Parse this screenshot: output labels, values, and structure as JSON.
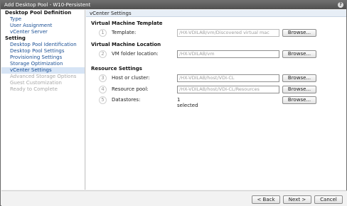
{
  "window": {
    "title": "Add Desktop Pool - W10-Persistent",
    "help_glyph": "?"
  },
  "sidebar": {
    "groups": [
      {
        "heading": "Desktop Pool Definition",
        "items": [
          {
            "label": "Type",
            "state": "normal"
          },
          {
            "label": "User Assignment",
            "state": "normal"
          },
          {
            "label": "vCenter Server",
            "state": "normal"
          }
        ]
      },
      {
        "heading": "Setting",
        "items": [
          {
            "label": "Desktop Pool Identification",
            "state": "normal"
          },
          {
            "label": "Desktop Pool Settings",
            "state": "normal"
          },
          {
            "label": "Provisioning Settings",
            "state": "normal"
          },
          {
            "label": "Storage Optimization",
            "state": "normal"
          },
          {
            "label": "vCenter Settings",
            "state": "selected"
          },
          {
            "label": "Advanced Storage Options",
            "state": "disabled"
          },
          {
            "label": "Guest Customization",
            "state": "disabled"
          },
          {
            "label": "Ready to Complete",
            "state": "disabled"
          }
        ]
      }
    ]
  },
  "content": {
    "header": "vCenter Settings",
    "sections": {
      "vm_template": "Virtual Machine Template",
      "vm_location": "Virtual Machine Location",
      "resource": "Resource Settings"
    },
    "fields": [
      {
        "num": "1",
        "label": "Template:",
        "value": "/HX-VDILAB/vm/Discovered virtual mac",
        "button": "Browse..."
      },
      {
        "num": "2",
        "label": "VM folder location:",
        "value": "/HX-VDILAB/vm",
        "button": "Browse..."
      },
      {
        "num": "3",
        "label": "Host or cluster:",
        "value": "/HX-VDILAB/host/VDI-CL",
        "button": "Browse..."
      },
      {
        "num": "4",
        "label": "Resource pool:",
        "value": "/HX-VDILAB/host/VDI-CL/Resources",
        "button": "Browse..."
      },
      {
        "num": "5",
        "label": "Datastores:",
        "value": "1 selected",
        "button": "Browse..."
      }
    ]
  },
  "footer": {
    "back": "< Back",
    "next": "Next >",
    "cancel": "Cancel"
  }
}
